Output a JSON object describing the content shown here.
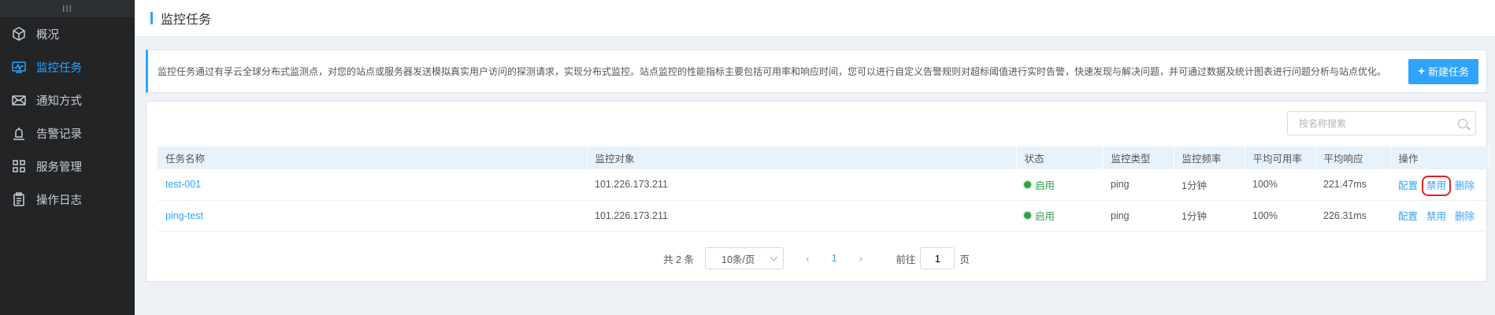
{
  "sidebar": {
    "handle": "III",
    "items": [
      {
        "label": "概况",
        "icon": "cube-icon",
        "active": false
      },
      {
        "label": "监控任务",
        "icon": "monitor-icon",
        "active": true
      },
      {
        "label": "通知方式",
        "icon": "mail-icon",
        "active": false
      },
      {
        "label": "告警记录",
        "icon": "alarm-icon",
        "active": false
      },
      {
        "label": "服务管理",
        "icon": "grid-icon",
        "active": false
      },
      {
        "label": "操作日志",
        "icon": "clipboard-icon",
        "active": false
      }
    ]
  },
  "header": {
    "title": "监控任务"
  },
  "notice": {
    "text": "监控任务通过有孚云全球分布式监测点，对您的站点或服务器发送模拟真实用户访问的探测请求，实现分布式监控。站点监控的性能指标主要包括可用率和响应时间，您可以进行自定义告警规则对超标阈值进行实时告警，快速发现与解决问题，并可通过数据及统计图表进行问题分析与站点优化。",
    "new_button": "新建任务"
  },
  "search": {
    "placeholder": "按名称搜索"
  },
  "table": {
    "headers": [
      "任务名称",
      "监控对象",
      "状态",
      "监控类型",
      "监控频率",
      "平均可用率",
      "平均响应",
      "操作"
    ],
    "rows": [
      {
        "name": "test-001",
        "target": "101.226.173.211",
        "status": "启用",
        "type": "ping",
        "freq": "1分钟",
        "avail": "100%",
        "resp": "221.47ms",
        "ops": [
          "配置",
          "禁用",
          "删除"
        ]
      },
      {
        "name": "ping-test",
        "target": "101.226.173.211",
        "status": "启用",
        "type": "ping",
        "freq": "1分钟",
        "avail": "100%",
        "resp": "226.31ms",
        "ops": [
          "配置",
          "禁用",
          "删除"
        ]
      }
    ]
  },
  "pagination": {
    "total": "共 2 条",
    "page_size": "10条/页",
    "prev": "‹",
    "current": "1",
    "next": "›",
    "goto_label": "前往",
    "goto_value": "1",
    "goto_suffix": "页"
  },
  "colors": {
    "accent": "#2fa4ff",
    "sidebar_bg": "#222426",
    "status_green": "#2aa34a",
    "highlight": "#e02020"
  }
}
